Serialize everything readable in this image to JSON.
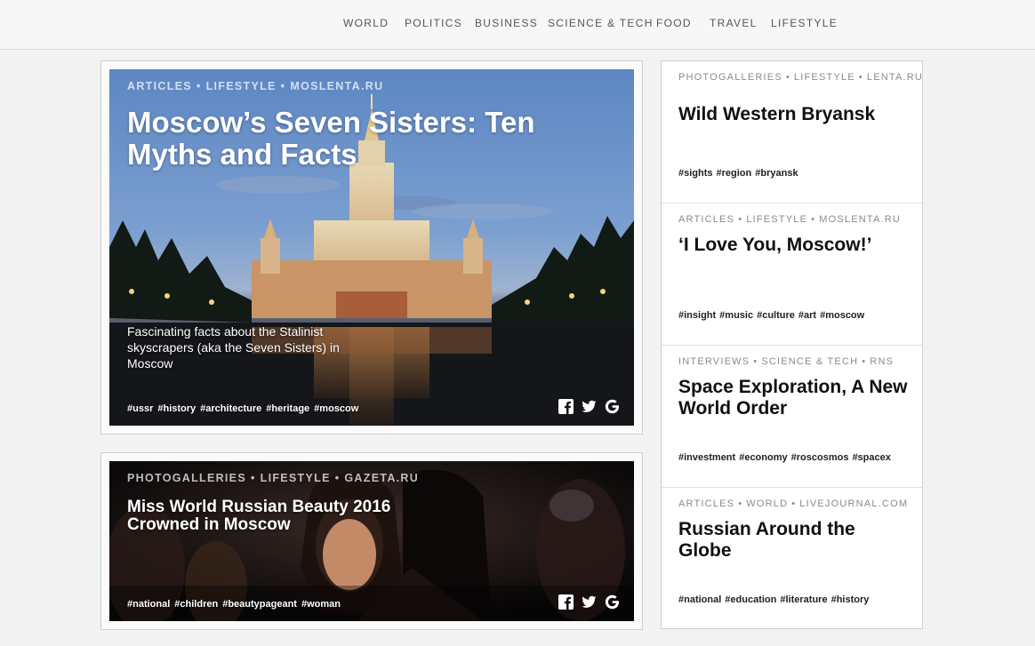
{
  "nav": {
    "items": [
      "WORLD",
      "POLITICS",
      "BUSINESS",
      "SCIENCE & TECH",
      "FOOD",
      "TRAVEL",
      "LIFESTYLE"
    ]
  },
  "hero": {
    "meta": [
      "ARTICLES",
      "LIFESTYLE",
      "MOSLENTA.RU"
    ],
    "title": "Moscow’s Seven Sisters: Ten Myths and Facts",
    "description": "Fascinating facts about the Stalinist skyscrapers (aka the Seven Sisters) in Moscow",
    "tags": [
      "#ussr",
      "#history",
      "#architecture",
      "#heritage",
      "#moscow"
    ]
  },
  "card2": {
    "meta": [
      "PHOTOGALLERIES",
      "LIFESTYLE",
      "GAZETA.RU"
    ],
    "title": "Miss World Russian Beauty 2016 Crowned in Moscow",
    "tags": [
      "#national",
      "#children",
      "#beautypageant",
      "#woman"
    ]
  },
  "sidebar": [
    {
      "meta": [
        "PHOTOGALLERIES",
        "LIFESTYLE",
        "LENTA.RU"
      ],
      "title": "Wild Western Bryansk",
      "tags": [
        "#sights",
        "#region",
        "#bryansk"
      ]
    },
    {
      "meta": [
        "ARTICLES",
        "LIFESTYLE",
        "MOSLENTA.RU"
      ],
      "title": "‘I Love You, Moscow!’",
      "tags": [
        "#insight",
        "#music",
        "#culture",
        "#art",
        "#moscow"
      ]
    },
    {
      "meta": [
        "INTERVIEWS",
        "SCIENCE & TECH",
        "RNS"
      ],
      "title": "Space Exploration, A New World Order",
      "tags": [
        "#investment",
        "#economy",
        "#roscosmos",
        "#spacex"
      ]
    },
    {
      "meta": [
        "ARTICLES",
        "WORLD",
        "LIVEJOURNAL.COM"
      ],
      "title": "Russian Around the Globe",
      "tags": [
        "#national",
        "#education",
        "#literature",
        "#history"
      ]
    }
  ],
  "share_icons": [
    "facebook-icon",
    "twitter-icon",
    "google-icon"
  ]
}
